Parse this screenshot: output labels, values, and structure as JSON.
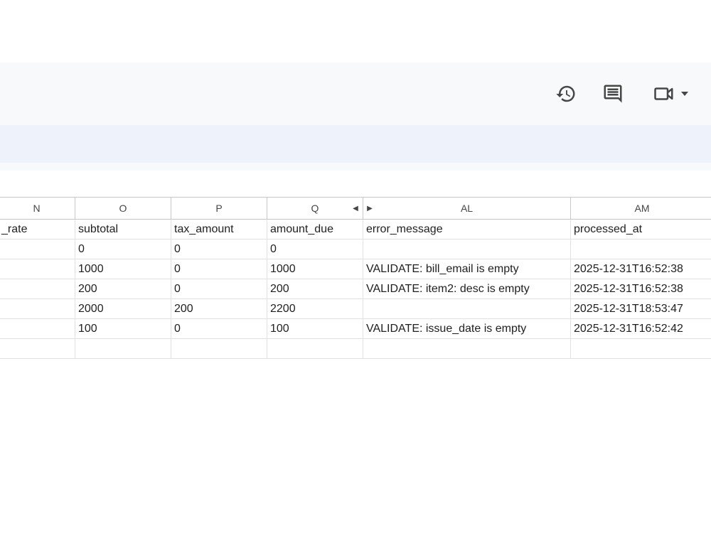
{
  "header": {
    "icons": [
      {
        "name": "version-history-icon"
      },
      {
        "name": "comments-icon"
      },
      {
        "name": "meet-call-icon"
      }
    ]
  },
  "columns": [
    "N",
    "O",
    "P",
    "Q",
    "AL",
    "AM"
  ],
  "rows": [
    {
      "N": "_rate",
      "O": "subtotal",
      "P": "tax_amount",
      "Q": "amount_due",
      "AL": "error_message",
      "AM": "processed_at"
    },
    {
      "N": "",
      "O": "0",
      "P": "0",
      "Q": "0",
      "AL": "",
      "AM": ""
    },
    {
      "N": "",
      "O": "1000",
      "P": "0",
      "Q": "1000",
      "AL": "VALIDATE: bill_email is empty",
      "AM": "2025-12-31T16:52:38"
    },
    {
      "N": "",
      "O": "200",
      "P": "0",
      "Q": "200",
      "AL": "VALIDATE: item2: desc is empty",
      "AM": "2025-12-31T16:52:38"
    },
    {
      "N": "",
      "O": "2000",
      "P": "200",
      "Q": "2200",
      "AL": "",
      "AM": "2025-12-31T18:53:47"
    },
    {
      "N": "",
      "O": "100",
      "P": "0",
      "Q": "100",
      "AL": "VALIDATE: issue_date is empty",
      "AM": "2025-12-31T16:52:42"
    },
    {
      "N": "",
      "O": "",
      "P": "",
      "Q": "",
      "AL": "",
      "AM": ""
    }
  ]
}
